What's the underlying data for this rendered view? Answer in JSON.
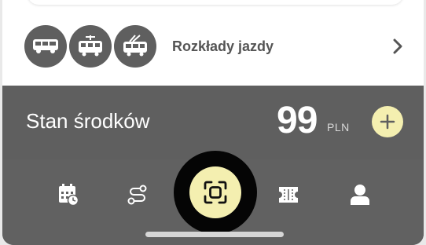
{
  "timetable": {
    "label": "Rozkłady jazdy",
    "vehicles": [
      "bus-icon",
      "tram-icon",
      "trolleybus-icon"
    ]
  },
  "balance": {
    "label": "Stan środków",
    "amount": "99",
    "currency": "PLN"
  },
  "nav": {
    "items": [
      "calendar-clock-icon",
      "route-icon",
      "scan-icon",
      "ticket-icon",
      "profile-icon"
    ]
  },
  "colors": {
    "accent": "#f4efb0",
    "panel": "#5f5f5f",
    "background": "#ffffff"
  }
}
